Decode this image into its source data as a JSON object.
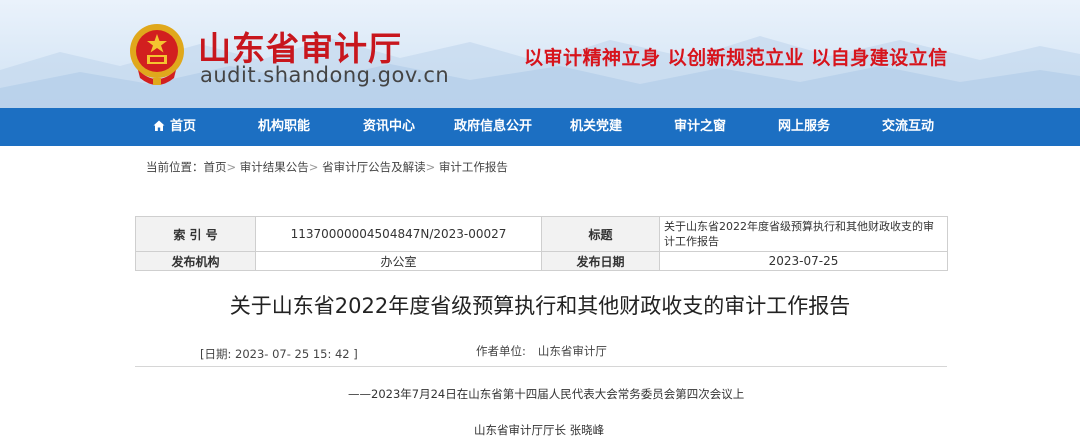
{
  "header": {
    "site_title": "山东省审计厅",
    "site_domain": "audit.shandong.gov.cn",
    "slogan": "以审计精神立身  以创新规范立业  以自身建设立信"
  },
  "nav": {
    "items": [
      {
        "label": "首页",
        "icon": "home-icon"
      },
      {
        "label": "机构职能"
      },
      {
        "label": "资讯中心"
      },
      {
        "label": "政府信息公开"
      },
      {
        "label": "机关党建"
      },
      {
        "label": "审计之窗"
      },
      {
        "label": "网上服务"
      },
      {
        "label": "交流互动"
      }
    ]
  },
  "breadcrumb": {
    "prefix": "当前位置：",
    "items": [
      "首页",
      "审计结果公告",
      "省审计厅公告及解读",
      "审计工作报告"
    ],
    "separator": ">"
  },
  "info": {
    "index_label": "索 引 号",
    "index_value": "11370000004504847N/2023-00027",
    "title_label": "标题",
    "title_value": "关于山东省2022年度省级预算执行和其他财政收支的审计工作报告",
    "org_label": "发布机构",
    "org_value": "办公室",
    "date_label": "发布日期",
    "date_value": "2023-07-25"
  },
  "article": {
    "title": "关于山东省2022年度省级预算执行和其他财政收支的审计工作报告",
    "date_text": "[日期:   2023- 07- 25 15: 42 ]",
    "author_label": "作者单位:",
    "author_value": "山东省审计厅",
    "subtitle": "——2023年7月24日在山东省第十四届人民代表大会常务委员会第四次会议上",
    "speaker": "山东省审计厅厅长  张晓峰"
  },
  "colors": {
    "brand_red": "#c8161d",
    "nav_blue": "#1c6fc2"
  }
}
